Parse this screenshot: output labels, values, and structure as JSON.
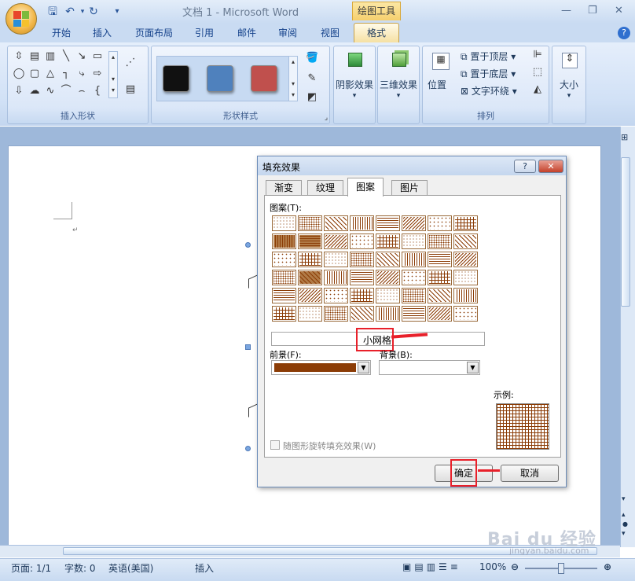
{
  "window": {
    "title": "文档 1 - Microsoft Word",
    "context_tab_group": "绘图工具"
  },
  "qat": {
    "save": "save-icon",
    "undo": "undo-icon",
    "redo": "redo-icon"
  },
  "tabs": [
    {
      "label": "开始"
    },
    {
      "label": "插入"
    },
    {
      "label": "页面布局"
    },
    {
      "label": "引用"
    },
    {
      "label": "邮件"
    },
    {
      "label": "审阅"
    },
    {
      "label": "视图"
    },
    {
      "label": "格式"
    }
  ],
  "ribbon": {
    "insert_shapes_label": "插入形状",
    "shape_styles_label": "形状样式",
    "shadow_effects": "阴影效果",
    "threed_effects": "三维效果",
    "position": "位置",
    "bring_to_front": "置于顶层",
    "send_to_back": "置于底层",
    "text_wrap": "文字环绕",
    "arrange_label": "排列",
    "size": "大小",
    "style_colors": [
      "#111111",
      "#4f81bd",
      "#c0504d"
    ]
  },
  "dialog": {
    "title": "填充效果",
    "help": "?",
    "tabs": [
      "渐变",
      "纹理",
      "图案",
      "图片"
    ],
    "active_tab": "图案",
    "pattern_label": "图案(T):",
    "pattern_name": "小网格",
    "foreground_label": "前景(F):",
    "background_label": "背景(B):",
    "foreground_color": "#8b3c06",
    "sample_label": "示例:",
    "rotate_checkbox": "随图形旋转填充效果(W)",
    "ok": "确定",
    "cancel": "取消"
  },
  "statusbar": {
    "page": "页面: 1/1",
    "words": "字数: 0",
    "language": "英语(美国)",
    "mode": "插入",
    "zoom": "100%"
  },
  "watermark": {
    "text": "Bai du 经验",
    "url": "jingyan.baidu.com"
  }
}
